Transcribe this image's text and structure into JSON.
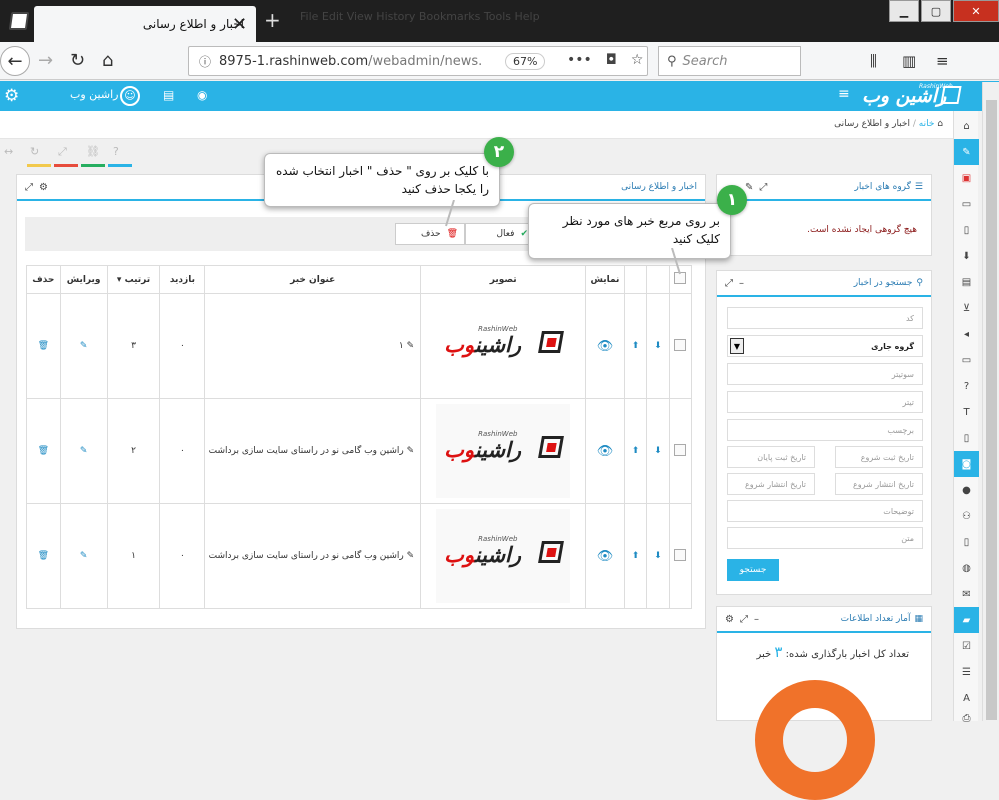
{
  "browser": {
    "tab_title": "اخبار و اطلاع رسانی",
    "tab_close": "✕",
    "new_tab": "+",
    "menu_hint": "File   Edit   View   History   Bookmarks   Tools   Help",
    "url_main": "8975-1.rashinweb.com",
    "url_path": "/webadmin/news.",
    "zoom": "67%",
    "search_placeholder": "Search",
    "win_min": "▁",
    "win_max": "▢",
    "win_close": "✕"
  },
  "app": {
    "brand": "راشین وب",
    "brand_sub": "RashinWeb",
    "user": "راشین وب"
  },
  "breadcrumb": {
    "home": "خانه",
    "sep": "/",
    "current": "اخبار و اطلاع رسانی"
  },
  "news_panel": {
    "title": "اخبار و اطلاع رسانی",
    "btn_delete": "حذف",
    "btn_active": "فعال",
    "columns": [
      "",
      "",
      "",
      "نمایش",
      "تصویر",
      "عنوان خبر",
      "بازدید",
      "ترتیب",
      "ویرایش",
      "حذف"
    ],
    "sort_marker": "▾",
    "rows": [
      {
        "title": "۱",
        "visits": "۰",
        "order": "۳"
      },
      {
        "title": "راشین وب گامی نو در راستای سایت سازی برداشت",
        "visits": "۰",
        "order": "۲"
      },
      {
        "title": "راشین وب گامی نو در راستای سایت سازی برداشت",
        "visits": "۰",
        "order": "۱"
      }
    ],
    "logo_text_a": "راشین",
    "logo_text_b": "وب",
    "logo_sub": "RashinWeb"
  },
  "groups_panel": {
    "title": "گروه های اخبار",
    "empty": "هیچ گروهی ایجاد نشده است."
  },
  "search_panel": {
    "title": "جستجو در اخبار",
    "code": "کد",
    "group_select": "گروه جاری",
    "subtitle": "سوتیتر",
    "heading": "تیتر",
    "tag": "برچسب",
    "reg_start": "تاریخ ثبت شروع",
    "reg_end": "تاریخ ثبت پایان",
    "pub_start": "تاریخ انتشار شروع",
    "pub_end": "تاریخ انتشار شروع",
    "desc": "توضیحات",
    "text": "متن",
    "go": "جستجو"
  },
  "stats_panel": {
    "title": "آمار تعداد اطلاعات",
    "line_label": "تعداد کل اخبار بارگذاری شده:",
    "count": "۳",
    "unit": "خبر"
  },
  "callouts": {
    "one_num": "۱",
    "one_text": "بر روی مربع خبر های مورد نظر کلیک کنید",
    "two_num": "۲",
    "two_text": "با کلیک بر روی \" حذف \" اخبار انتخاب شده را یکجا حذف کنید"
  },
  "colors": {
    "accent": "#2ab3e6",
    "brand_red": "#d11111",
    "callout_green": "#3bb04a",
    "donut": "#f0722a"
  }
}
